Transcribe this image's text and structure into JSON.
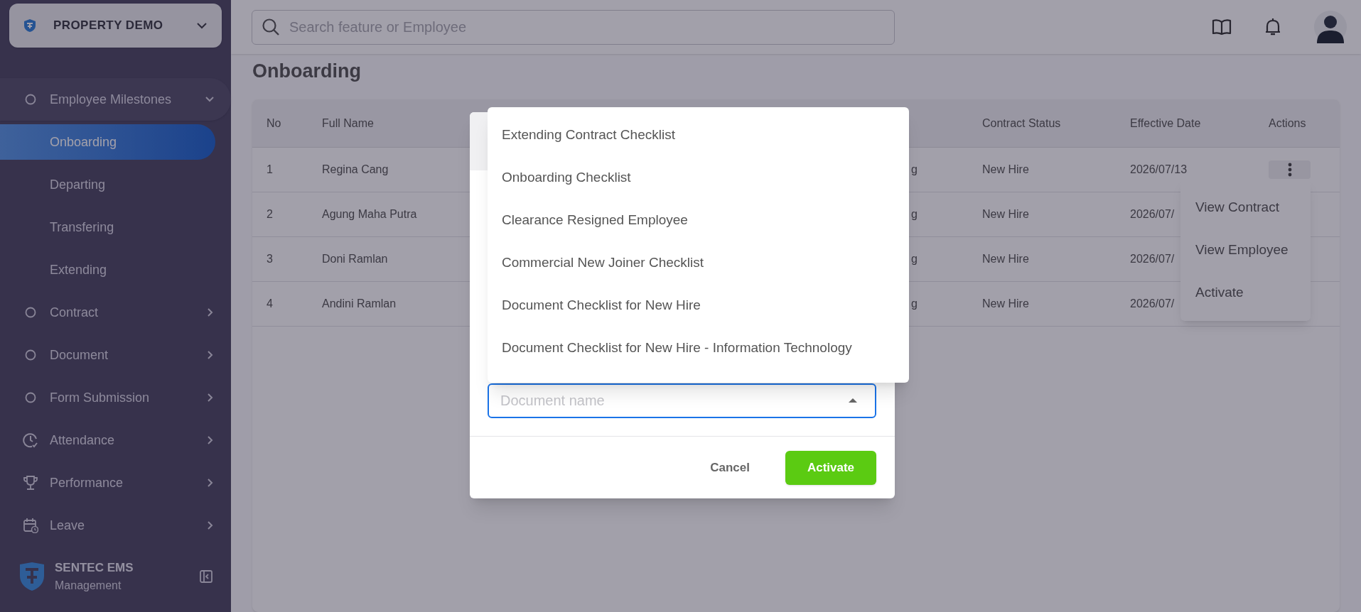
{
  "workspace": {
    "name": "PROPERTY DEMO"
  },
  "search": {
    "placeholder": "Search feature or Employee"
  },
  "sidebar": {
    "items": [
      {
        "label": "Employee Milestones",
        "kind": "circle",
        "expanded": true,
        "children": [
          {
            "label": "Onboarding",
            "selected": true
          },
          {
            "label": "Departing",
            "selected": false
          },
          {
            "label": "Transfering",
            "selected": false
          },
          {
            "label": "Extending",
            "selected": false
          }
        ]
      },
      {
        "label": "Contract",
        "kind": "circle",
        "expanded": false
      },
      {
        "label": "Document",
        "kind": "circle",
        "expanded": false
      },
      {
        "label": "Form Submission",
        "kind": "circle",
        "expanded": false
      },
      {
        "label": "Attendance",
        "kind": "clock",
        "expanded": false
      },
      {
        "label": "Performance",
        "kind": "trophy",
        "expanded": false
      },
      {
        "label": "Leave",
        "kind": "calendar",
        "expanded": false
      }
    ]
  },
  "brand": {
    "name": "SENTEC EMS",
    "subtitle": "Management"
  },
  "page_title": "Onboarding",
  "table": {
    "columns": [
      "No",
      "Full Name",
      "Contract Status",
      "Effective Date",
      "Actions"
    ],
    "rows": [
      {
        "no": "1",
        "full_name": "Regina Cang",
        "column_3": "g",
        "contract_status": "New Hire",
        "effective_date": "2026/07/13"
      },
      {
        "no": "2",
        "full_name": "Agung Maha Putra",
        "column_3": "g",
        "contract_status": "New Hire",
        "effective_date": "2026/07/"
      },
      {
        "no": "3",
        "full_name": "Doni Ramlan",
        "column_3": "g",
        "contract_status": "New Hire",
        "effective_date": "2026/07/"
      },
      {
        "no": "4",
        "full_name": "Andini Ramlan",
        "column_3": "g",
        "contract_status": "New Hire",
        "effective_date": "2026/07/"
      }
    ]
  },
  "row_menu": {
    "items": [
      "View Contract",
      "View Employee",
      "Activate"
    ]
  },
  "dialog": {
    "field": {
      "placeholder": "Document name"
    },
    "options": [
      "Extending Contract Checklist",
      "Onboarding Checklist",
      "Clearance Resigned Employee",
      "Commercial New Joiner Checklist",
      "Document Checklist for New Hire",
      "Document Checklist for New Hire - Information Technology"
    ],
    "buttons": [
      {
        "label": "Cancel",
        "kind": "text"
      },
      {
        "label": "Activate",
        "kind": "primary"
      }
    ]
  }
}
